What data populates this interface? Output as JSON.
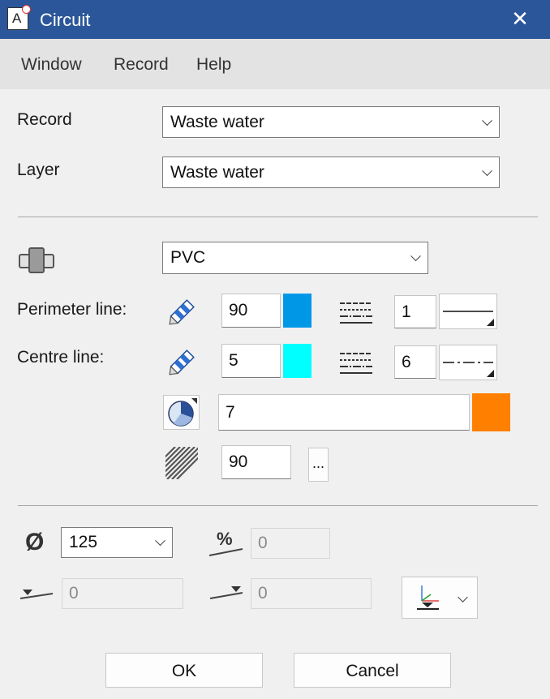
{
  "window": {
    "title": "Circuit",
    "app_icon_letter": "A",
    "close_glyph": "✕"
  },
  "menu": {
    "items": [
      "Window",
      "Record",
      "Help"
    ]
  },
  "record": {
    "label": "Record",
    "value": "Waste water"
  },
  "layer": {
    "label": "Layer",
    "value": "Waste water"
  },
  "material": {
    "icon": "pipe-joint-icon",
    "value": "PVC"
  },
  "perimeter_line": {
    "label": "Perimeter line:",
    "pen_value": "90",
    "pen_color": "#0098e6",
    "linetype_value": "1",
    "linestyle": "solid"
  },
  "centre_line": {
    "label": "Centre line:",
    "pen_value": "5",
    "pen_color": "#00ffff",
    "linetype_value": "6",
    "linestyle": "dash-dot"
  },
  "fill": {
    "value": "7",
    "color": "#ff8000"
  },
  "hatch": {
    "value": "90",
    "more_label": "..."
  },
  "diameter": {
    "symbol": "Ø",
    "value": "125"
  },
  "slope_percent": {
    "symbol": "%",
    "value": "0"
  },
  "elevation_start": {
    "value": "0"
  },
  "elevation_end": {
    "value": "0"
  },
  "buttons": {
    "ok": "OK",
    "cancel": "Cancel"
  }
}
